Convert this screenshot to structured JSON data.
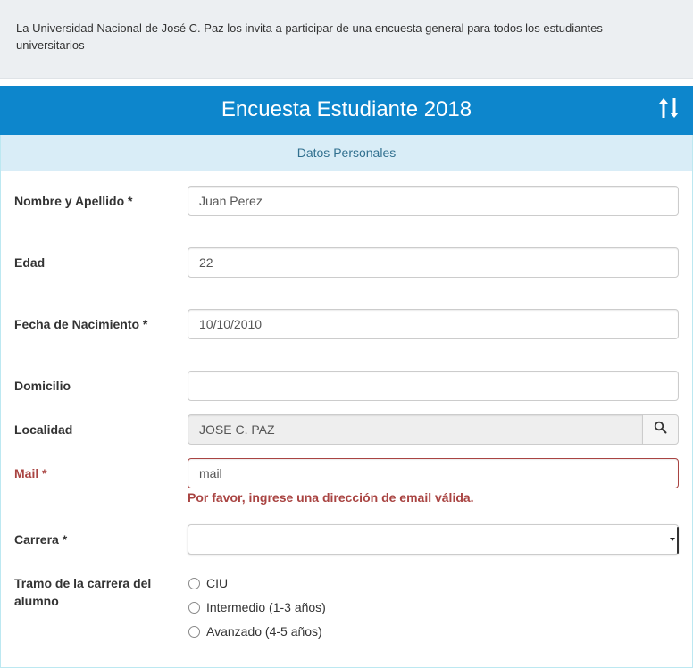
{
  "intro": {
    "text": "La Universidad Nacional de José C. Paz los  invita a participar de una encuesta general para todos los estudiantes universitarios"
  },
  "header": {
    "title": "Encuesta Estudiante 2018",
    "icon": "sort-arrows-icon",
    "background": "#0d86cc"
  },
  "panel": {
    "heading": "Datos Personales"
  },
  "form": {
    "nombre": {
      "label": "Nombre y Apellido *",
      "value": "Juan Perez"
    },
    "edad": {
      "label": "Edad",
      "value": "22"
    },
    "fecha": {
      "label": "Fecha de Nacimiento *",
      "value": "10/10/2010"
    },
    "domicilio": {
      "label": "Domicilio",
      "value": ""
    },
    "localidad": {
      "label": "Localidad",
      "value": "JOSE C. PAZ",
      "button_icon": "search-icon"
    },
    "mail": {
      "label": "Mail *",
      "value": "mail",
      "error": "Por favor, ingrese una dirección de email válida.",
      "error_color": "#a94442"
    },
    "carrera": {
      "label": "Carrera *",
      "value": ""
    },
    "tramo": {
      "label": "Tramo de la carrera del alumno",
      "options": [
        "CIU",
        "Intermedio (1-3 años)",
        "Avanzado (4-5 años)"
      ]
    }
  }
}
